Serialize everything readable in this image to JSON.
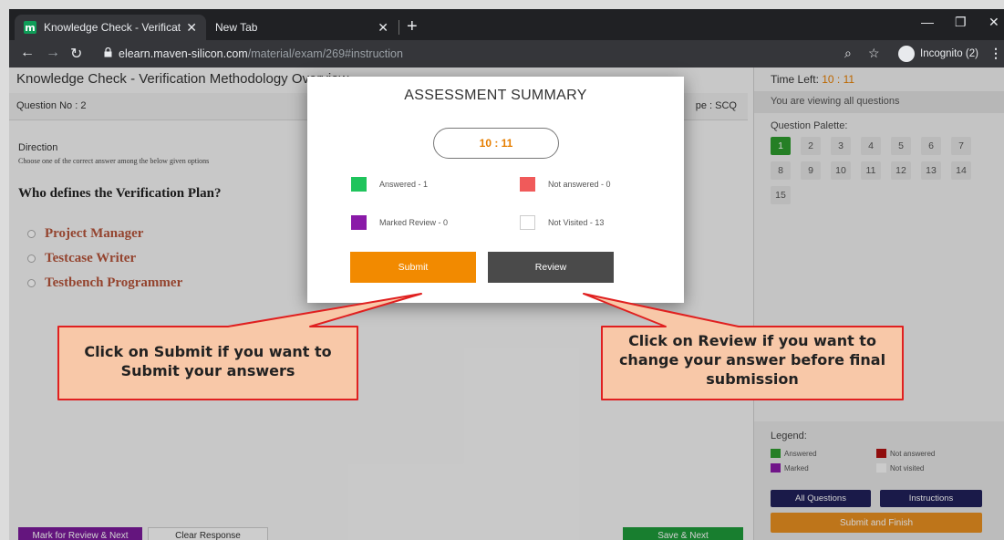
{
  "browser": {
    "tabs": [
      {
        "title": "Knowledge Check - Verification M",
        "favicon": "m"
      },
      {
        "title": "New Tab"
      }
    ],
    "url_host": "elearn.maven-silicon.com",
    "url_path": "/material/exam/269#instruction",
    "incognito_label": "Incognito (2)"
  },
  "exam": {
    "title": "Knowledge Check - Verification Methodology Overview",
    "question_no": "Question No : 2",
    "question_type": "pe : SCQ",
    "direction_label": "Direction",
    "direction_text": "Choose one of the correct answer among the below given options",
    "question": "Who defines the Verification Plan?",
    "options": [
      "Project Manager",
      "Testcase Writer",
      "Testbench Programmer"
    ]
  },
  "side_panel": {
    "time_left_label": "Time Left:",
    "time_left_value": "10 : 11",
    "viewing_text": "You are viewing all questions",
    "palette_title": "Question Palette:",
    "palette": [
      "1",
      "2",
      "3",
      "4",
      "5",
      "6",
      "7",
      "8",
      "9",
      "10",
      "11",
      "12",
      "13",
      "14",
      "15"
    ],
    "answered_index": 0,
    "legend_title": "Legend:",
    "legend": {
      "answered": "Answered",
      "not_answered": "Not answered",
      "marked": "Marked",
      "not_visited": "Not visited"
    },
    "all_questions_label": "All Questions",
    "instructions_label": "Instructions",
    "submit_finish_label": "Submit and Finish"
  },
  "bottom_bar": {
    "mark_review_label": "Mark for Review & Next",
    "clear_label": "Clear Response",
    "save_next_label": "Save & Next"
  },
  "modal": {
    "title": "ASSESSMENT SUMMARY",
    "timer": "10 : 11",
    "answered": "Answered - 1",
    "not_answered": "Not answered - 0",
    "marked_review": "Marked Review - 0",
    "not_visited": "Not Visited - 13",
    "submit_label": "Submit",
    "review_label": "Review"
  },
  "callouts": {
    "submit_line1": "Click on Submit if you want to",
    "submit_line2": "Submit your answers",
    "review_line1": "Click on Review if you want to",
    "review_line2": "change your answer before final",
    "review_line3": "submission"
  },
  "colors": {
    "answered": "#2e9b2e",
    "modal_answered": "#1fc45c",
    "not_answered": "#f05a5a",
    "marked": "#8a1aa8",
    "submit": "#f28a00",
    "review": "#4a4a4a",
    "callout_fill": "#f8c8a8",
    "callout_border": "#e02020"
  }
}
